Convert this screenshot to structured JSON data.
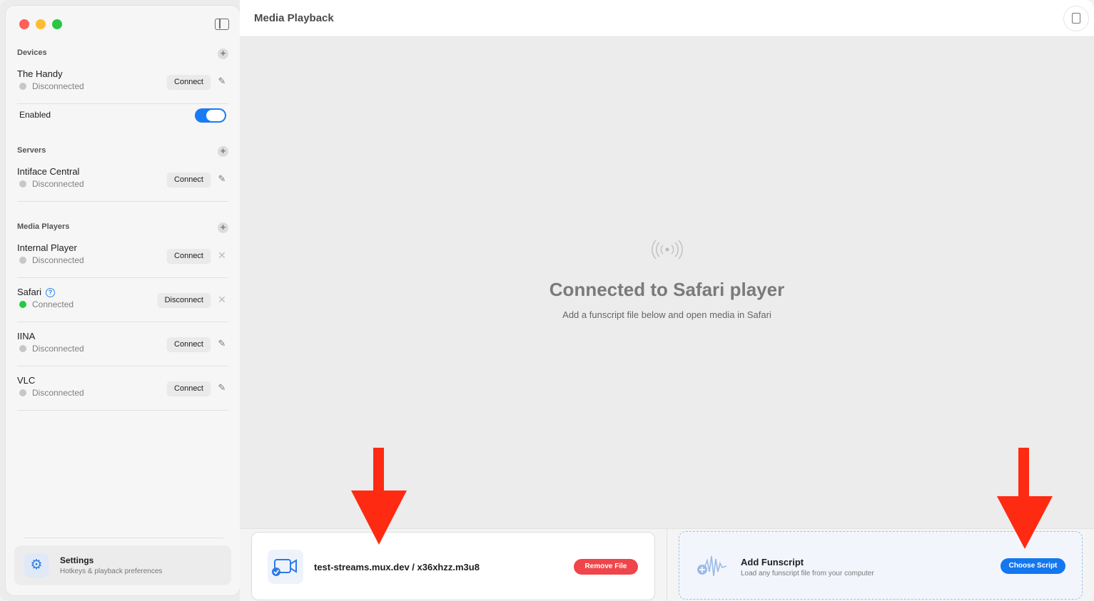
{
  "window": {
    "title": "Media Playback"
  },
  "sidebar": {
    "sections": {
      "devices": {
        "header": "Devices",
        "add_symbol": "+",
        "items": [
          {
            "name": "The Handy",
            "status": "Disconnected",
            "button": "Connect"
          }
        ],
        "enabled_label": "Enabled",
        "enabled": true
      },
      "servers": {
        "header": "Servers",
        "add_symbol": "+",
        "items": [
          {
            "name": "Intiface Central",
            "status": "Disconnected",
            "button": "Connect"
          }
        ]
      },
      "media_players": {
        "header": "Media Players",
        "add_symbol": "+",
        "items": [
          {
            "name": "Internal Player",
            "status": "Disconnected",
            "button": "Connect"
          },
          {
            "name": "Safari",
            "status": "Connected",
            "button": "Disconnect"
          },
          {
            "name": "IINA",
            "status": "Disconnected",
            "button": "Connect"
          },
          {
            "name": "VLC",
            "status": "Disconnected",
            "button": "Connect"
          }
        ]
      }
    },
    "settings": {
      "title": "Settings",
      "subtitle": "Hotkeys & playback preferences"
    }
  },
  "main": {
    "status_title": "Connected to Safari player",
    "status_subtitle": "Add a funscript file below and open media in Safari"
  },
  "bottom": {
    "file": {
      "name": "test-streams.mux.dev / x36xhzz.m3u8",
      "remove_label": "Remove File"
    },
    "script": {
      "title": "Add Funscript",
      "subtitle": "Load any funscript file from your computer",
      "button_label": "Choose Script"
    }
  },
  "colors": {
    "accent": "#1477f0",
    "danger": "#f0454a",
    "connected": "#28c840",
    "annotation_arrow": "#ff2a12"
  },
  "icons": {
    "sidebar_toggle": "sidebar-toggle-icon",
    "inspector": "document-search-icon",
    "broadcast": "broadcast-icon",
    "video_file": "video-check-icon",
    "waveform": "waveform-add-icon",
    "settings": "gear-icon",
    "help": "question-circle-icon",
    "edit": "pencil-icon",
    "remove": "close-icon"
  }
}
